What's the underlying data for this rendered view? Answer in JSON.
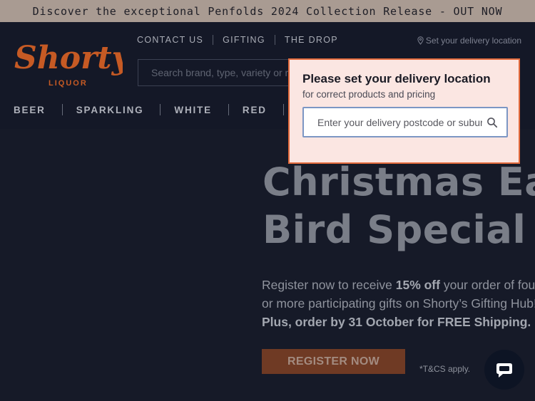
{
  "announcement": "Discover the exceptional Penfolds 2024 Collection Release  - OUT NOW",
  "brand": {
    "logo_text": "Shortys",
    "logo_subtext": "LIQUOR",
    "accent": "#c65a24"
  },
  "top_nav": {
    "items": [
      "CONTACT US",
      "GIFTING",
      "THE DROP"
    ]
  },
  "delivery_link": "Set your delivery location",
  "search": {
    "placeholder": "Search brand, type, variety or region"
  },
  "categories": [
    "BEER",
    "SPARKLING",
    "WHITE",
    "RED"
  ],
  "hero": {
    "title_line1": "Christmas Ea",
    "title_line2": "Bird Special",
    "text_line1_a": "Register now to receive ",
    "text_line1_b": "15% off",
    "text_line1_c": " your order of four",
    "text_line2": "or more participating gifts on Shorty’s Gifting Hub!*",
    "text_line3": "Plus, order by 31 October for FREE Shipping.",
    "cta": "REGISTER NOW",
    "terms": "*T&CS apply."
  },
  "delivery_popup": {
    "title": "Please set your delivery location",
    "subtitle": "for correct products and pricing",
    "placeholder": "Enter your delivery postcode or suburb"
  },
  "icons": {
    "search": "search-icon",
    "pin": "location-pin-icon",
    "chat": "chat-icon"
  }
}
